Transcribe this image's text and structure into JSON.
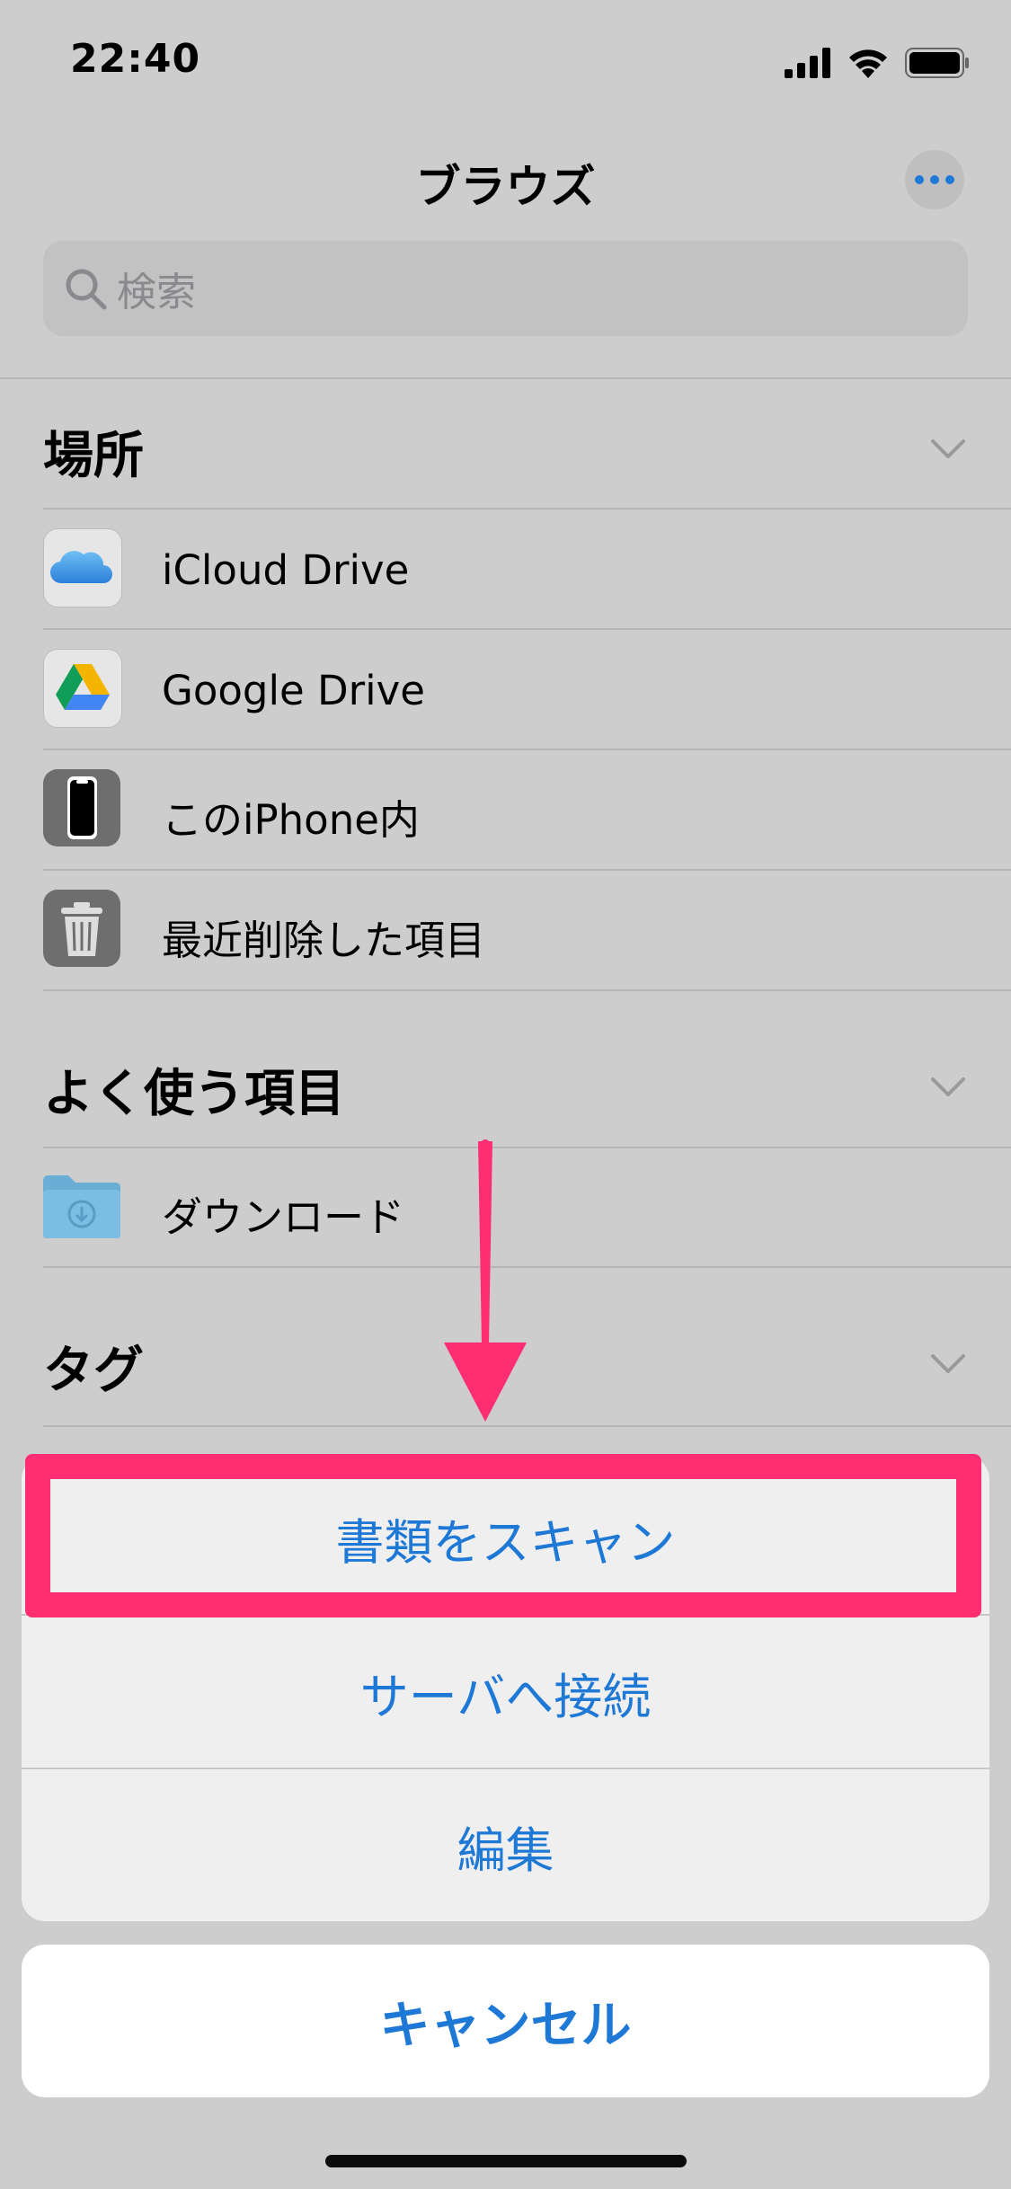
{
  "status_bar": {
    "time": "22:40"
  },
  "nav": {
    "title": "ブラウズ"
  },
  "search": {
    "placeholder": "検索"
  },
  "sections": {
    "locations": {
      "title": "場所",
      "items": [
        {
          "label": "iCloud Drive",
          "icon": "icloud-icon"
        },
        {
          "label": "Google Drive",
          "icon": "google-drive-icon"
        },
        {
          "label": "このiPhone内",
          "icon": "iphone-icon"
        },
        {
          "label": "最近削除した項目",
          "icon": "trash-icon"
        }
      ]
    },
    "favorites": {
      "title": "よく使う項目",
      "items": [
        {
          "label": "ダウンロード",
          "icon": "download-folder-icon"
        }
      ]
    },
    "tags": {
      "title": "タグ"
    }
  },
  "action_sheet": {
    "items": [
      "書類をスキャン",
      "サーバへ接続",
      "編集"
    ],
    "cancel": "キャンセル"
  },
  "colors": {
    "accent": "#1E78D6",
    "highlight": "#FF2D72",
    "arrow": "#FF2D72"
  }
}
